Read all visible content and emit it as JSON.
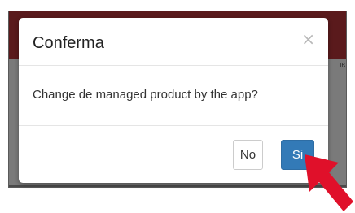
{
  "dialog": {
    "title": "Conferma",
    "close_glyph": "×",
    "message": "Change de managed product by the app?",
    "buttons": {
      "no_label": "No",
      "yes_label": "Si"
    }
  },
  "background": {
    "edge_text": "IR"
  },
  "colors": {
    "backdrop": "#7a7a7a",
    "header_bar": "#5a1a1c",
    "primary_button": "#337ab7",
    "pointer_arrow": "#e0102a"
  },
  "icons": {
    "close": "close-icon",
    "pointer": "red-arrow-pointer"
  }
}
